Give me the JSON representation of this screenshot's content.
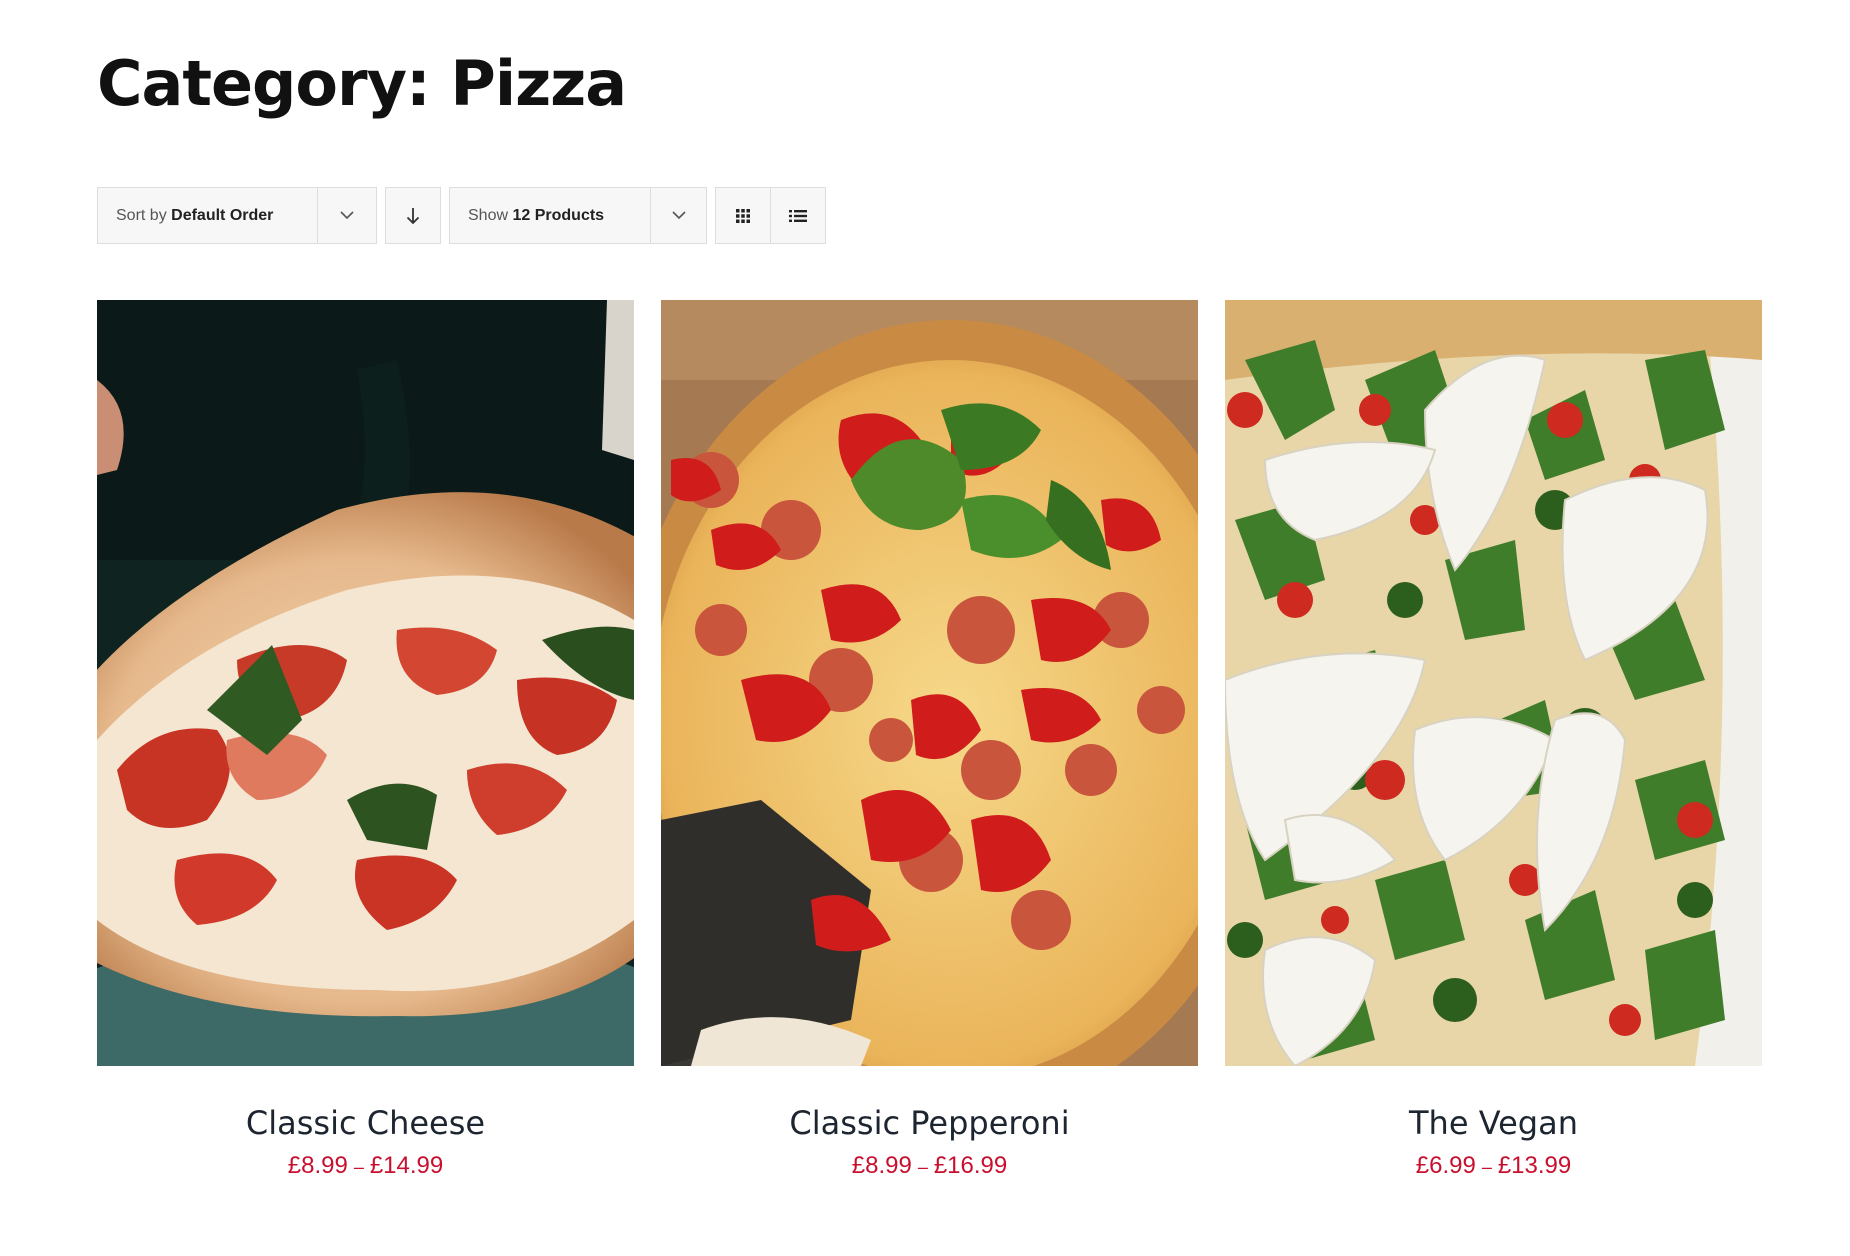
{
  "page": {
    "title": "Category: Pizza"
  },
  "toolbar": {
    "sort_prefix": "Sort by",
    "sort_value": "Default Order",
    "sort_direction_icon": "arrow-down-icon",
    "show_prefix": "Show",
    "show_value": "12 Products",
    "view_grid_icon": "grid-view-icon",
    "view_list_icon": "list-view-icon"
  },
  "colors": {
    "price": "#c8102e",
    "title": "#111111",
    "product_name": "#1c2530",
    "toolbar_bg": "#f7f7f7",
    "toolbar_border": "#dddddd"
  },
  "products": [
    {
      "name": "Classic Cheese",
      "price_min": "£8.99",
      "price_sep": "–",
      "price_max": "£14.99",
      "image": "margherita pizza photo"
    },
    {
      "name": "Classic Pepperoni",
      "price_min": "£8.99",
      "price_sep": "–",
      "price_max": "£16.99",
      "image": "pepperoni pizza photo"
    },
    {
      "name": "The Vegan",
      "price_min": "£6.99",
      "price_sep": "–",
      "price_max": "£13.99",
      "image": "vegan pizza photo"
    }
  ]
}
